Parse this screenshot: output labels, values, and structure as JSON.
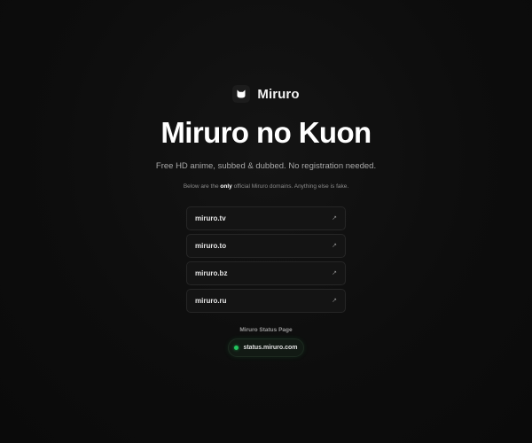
{
  "brand": {
    "name": "Miruro",
    "logo_icon": "cat-face-icon"
  },
  "hero": {
    "title": "Miruro no Kuon",
    "subtitle": "Free HD anime, subbed & dubbed. No registration needed."
  },
  "notice": {
    "prefix": "Below are the",
    "emphasis": "only",
    "suffix": "official Miruro domains. Anything else is fake."
  },
  "domains": [
    {
      "label": "miruro.tv",
      "icon": "external-arrow-icon",
      "glyph": "↗"
    },
    {
      "label": "miruro.to",
      "icon": "external-arrow-icon",
      "glyph": "↗"
    },
    {
      "label": "miruro.bz",
      "icon": "external-arrow-icon",
      "glyph": "↗"
    },
    {
      "label": "miruro.ru",
      "icon": "external-arrow-icon",
      "glyph": "↗"
    }
  ],
  "status": {
    "label": "Miruro Status Page",
    "link_text": "status.miruro.com",
    "indicator_color": "#22c55e"
  },
  "colors": {
    "background": "#0d0d0d",
    "card_background": "#141414",
    "card_border": "#262626",
    "status_green": "#22c55e"
  }
}
